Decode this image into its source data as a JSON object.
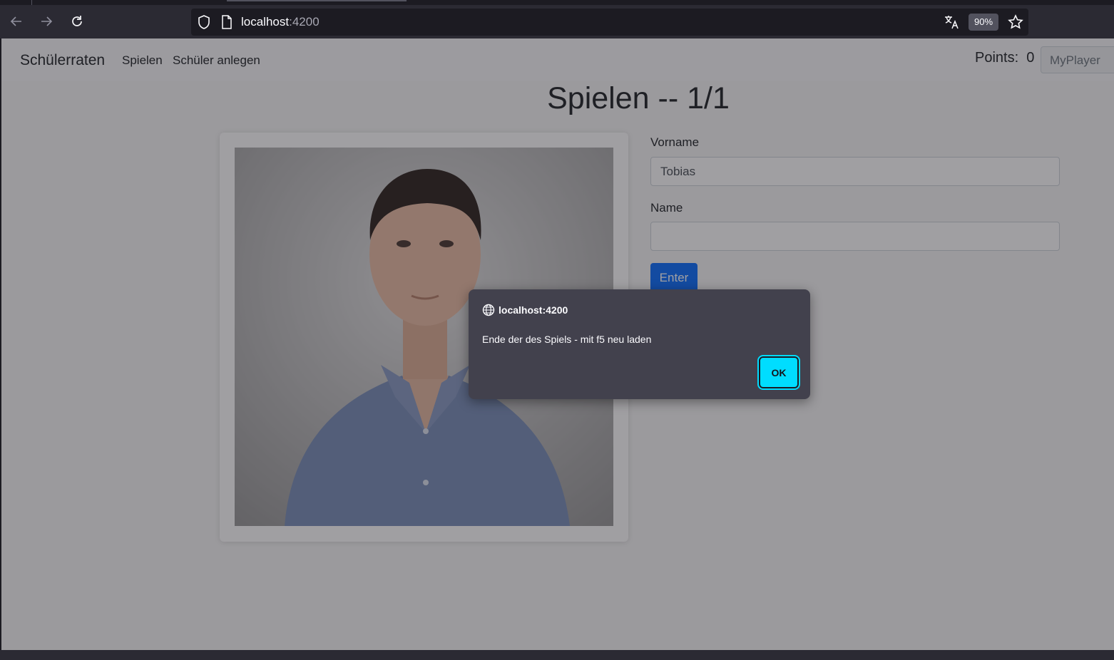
{
  "browser": {
    "url_host": "localhost",
    "url_port": ":4200",
    "zoom": "90%"
  },
  "app": {
    "brand": "Schülerraten",
    "nav": [
      "Spielen",
      "Schüler anlegen"
    ],
    "points_label": "Points:",
    "points_value": "0",
    "player": "MyPlayer",
    "title": "Spielen -- 1/1",
    "form": {
      "firstname_label": "Vorname",
      "firstname_value": "Tobias",
      "lastname_label": "Name",
      "lastname_value": "",
      "enter_label": "Enter"
    }
  },
  "dialog": {
    "origin": "localhost:4200",
    "message": "Ende der des Spiels - mit f5 neu laden",
    "ok_label": "OK"
  }
}
